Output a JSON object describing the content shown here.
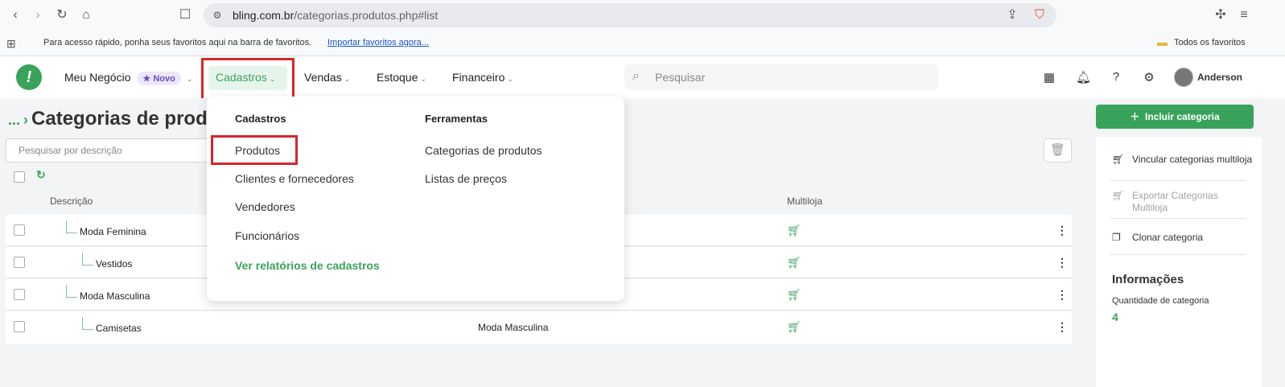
{
  "browser": {
    "url_domain": "bling.com.br",
    "url_path": "/categorias.produtos.php#list",
    "bookmarks_text": "Para acesso rápido, ponha seus favoritos aqui na barra de favoritos.",
    "bookmarks_link": "Importar favoritos agora...",
    "all_bookmarks": "Todos os favoritos"
  },
  "header": {
    "menu": [
      {
        "label": "Meu Negócio",
        "badge": "Novo"
      },
      {
        "label": "Cadastros"
      },
      {
        "label": "Vendas"
      },
      {
        "label": "Estoque"
      },
      {
        "label": "Financeiro"
      }
    ],
    "search_placeholder": "Pesquisar",
    "user_name": "Anderson"
  },
  "page": {
    "breadcrumb": "...",
    "title": "Categorias de prod",
    "filter_placeholder": "Pesquisar por descrição",
    "columns": {
      "description": "Descrição",
      "multistore": "Multiloja"
    }
  },
  "rows": [
    {
      "description": "Moda Feminina",
      "parent": ""
    },
    {
      "description": "Vestidos",
      "parent": ""
    },
    {
      "description": "Moda Masculina",
      "parent": ""
    },
    {
      "description": "Camisetas",
      "parent": "Moda Masculina"
    }
  ],
  "sidebar": {
    "include_button": "Incluir categoria",
    "actions": [
      {
        "label": "Vincular categorias multiloja",
        "enabled": true
      },
      {
        "label": "Exportar Categorias Multiloja",
        "enabled": false
      },
      {
        "label": "Clonar categoria",
        "enabled": true
      }
    ],
    "info_title": "Informações",
    "info_label": "Quantidade de categoria",
    "info_value": "4"
  },
  "dropdown": {
    "col1_title": "Cadastros",
    "col1_items": [
      "Produtos",
      "Clientes e fornecedores",
      "Vendedores",
      "Funcionários"
    ],
    "col1_link": "Ver relatórios de cadastros",
    "col2_title": "Ferramentas",
    "col2_items": [
      "Categorias de produtos",
      "Listas de preços"
    ]
  },
  "colors": {
    "accent": "#3aa35b",
    "highlight": "#d6262b"
  }
}
